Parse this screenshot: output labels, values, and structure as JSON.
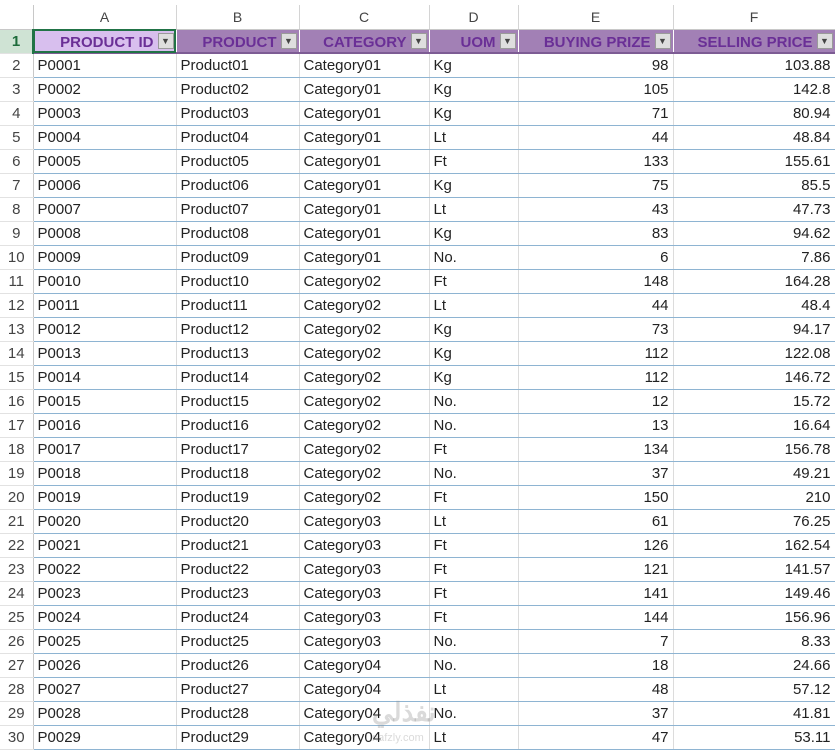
{
  "columns": [
    "A",
    "B",
    "C",
    "D",
    "E",
    "F"
  ],
  "header_row_number": "1",
  "headers": [
    "PRODUCT ID",
    "PRODUCT",
    "CATEGORY",
    "UOM",
    "BUYING PRIZE",
    "SELLING PRICE"
  ],
  "dropdown_glyph": "▼",
  "rows": [
    {
      "n": "2",
      "cells": [
        "P0001",
        "Product01",
        "Category01",
        "Kg",
        "98",
        "103.88"
      ]
    },
    {
      "n": "3",
      "cells": [
        "P0002",
        "Product02",
        "Category01",
        "Kg",
        "105",
        "142.8"
      ]
    },
    {
      "n": "4",
      "cells": [
        "P0003",
        "Product03",
        "Category01",
        "Kg",
        "71",
        "80.94"
      ]
    },
    {
      "n": "5",
      "cells": [
        "P0004",
        "Product04",
        "Category01",
        "Lt",
        "44",
        "48.84"
      ]
    },
    {
      "n": "6",
      "cells": [
        "P0005",
        "Product05",
        "Category01",
        "Ft",
        "133",
        "155.61"
      ]
    },
    {
      "n": "7",
      "cells": [
        "P0006",
        "Product06",
        "Category01",
        "Kg",
        "75",
        "85.5"
      ]
    },
    {
      "n": "8",
      "cells": [
        "P0007",
        "Product07",
        "Category01",
        "Lt",
        "43",
        "47.73"
      ]
    },
    {
      "n": "9",
      "cells": [
        "P0008",
        "Product08",
        "Category01",
        "Kg",
        "83",
        "94.62"
      ]
    },
    {
      "n": "10",
      "cells": [
        "P0009",
        "Product09",
        "Category01",
        "No.",
        "6",
        "7.86"
      ]
    },
    {
      "n": "11",
      "cells": [
        "P0010",
        "Product10",
        "Category02",
        "Ft",
        "148",
        "164.28"
      ]
    },
    {
      "n": "12",
      "cells": [
        "P0011",
        "Product11",
        "Category02",
        "Lt",
        "44",
        "48.4"
      ]
    },
    {
      "n": "13",
      "cells": [
        "P0012",
        "Product12",
        "Category02",
        "Kg",
        "73",
        "94.17"
      ]
    },
    {
      "n": "14",
      "cells": [
        "P0013",
        "Product13",
        "Category02",
        "Kg",
        "112",
        "122.08"
      ]
    },
    {
      "n": "15",
      "cells": [
        "P0014",
        "Product14",
        "Category02",
        "Kg",
        "112",
        "146.72"
      ]
    },
    {
      "n": "16",
      "cells": [
        "P0015",
        "Product15",
        "Category02",
        "No.",
        "12",
        "15.72"
      ]
    },
    {
      "n": "17",
      "cells": [
        "P0016",
        "Product16",
        "Category02",
        "No.",
        "13",
        "16.64"
      ]
    },
    {
      "n": "18",
      "cells": [
        "P0017",
        "Product17",
        "Category02",
        "Ft",
        "134",
        "156.78"
      ]
    },
    {
      "n": "19",
      "cells": [
        "P0018",
        "Product18",
        "Category02",
        "No.",
        "37",
        "49.21"
      ]
    },
    {
      "n": "20",
      "cells": [
        "P0019",
        "Product19",
        "Category02",
        "Ft",
        "150",
        "210"
      ]
    },
    {
      "n": "21",
      "cells": [
        "P0020",
        "Product20",
        "Category03",
        "Lt",
        "61",
        "76.25"
      ]
    },
    {
      "n": "22",
      "cells": [
        "P0021",
        "Product21",
        "Category03",
        "Ft",
        "126",
        "162.54"
      ]
    },
    {
      "n": "23",
      "cells": [
        "P0022",
        "Product22",
        "Category03",
        "Ft",
        "121",
        "141.57"
      ]
    },
    {
      "n": "24",
      "cells": [
        "P0023",
        "Product23",
        "Category03",
        "Ft",
        "141",
        "149.46"
      ]
    },
    {
      "n": "25",
      "cells": [
        "P0024",
        "Product24",
        "Category03",
        "Ft",
        "144",
        "156.96"
      ]
    },
    {
      "n": "26",
      "cells": [
        "P0025",
        "Product25",
        "Category03",
        "No.",
        "7",
        "8.33"
      ]
    },
    {
      "n": "27",
      "cells": [
        "P0026",
        "Product26",
        "Category04",
        "No.",
        "18",
        "24.66"
      ]
    },
    {
      "n": "28",
      "cells": [
        "P0027",
        "Product27",
        "Category04",
        "Lt",
        "48",
        "57.12"
      ]
    },
    {
      "n": "29",
      "cells": [
        "P0028",
        "Product28",
        "Category04",
        "No.",
        "37",
        "41.81"
      ]
    },
    {
      "n": "30",
      "cells": [
        "P0029",
        "Product29",
        "Category04",
        "Lt",
        "47",
        "53.11"
      ]
    }
  ],
  "watermark": {
    "text": "نفذلي",
    "sub": "nafzly.com"
  }
}
